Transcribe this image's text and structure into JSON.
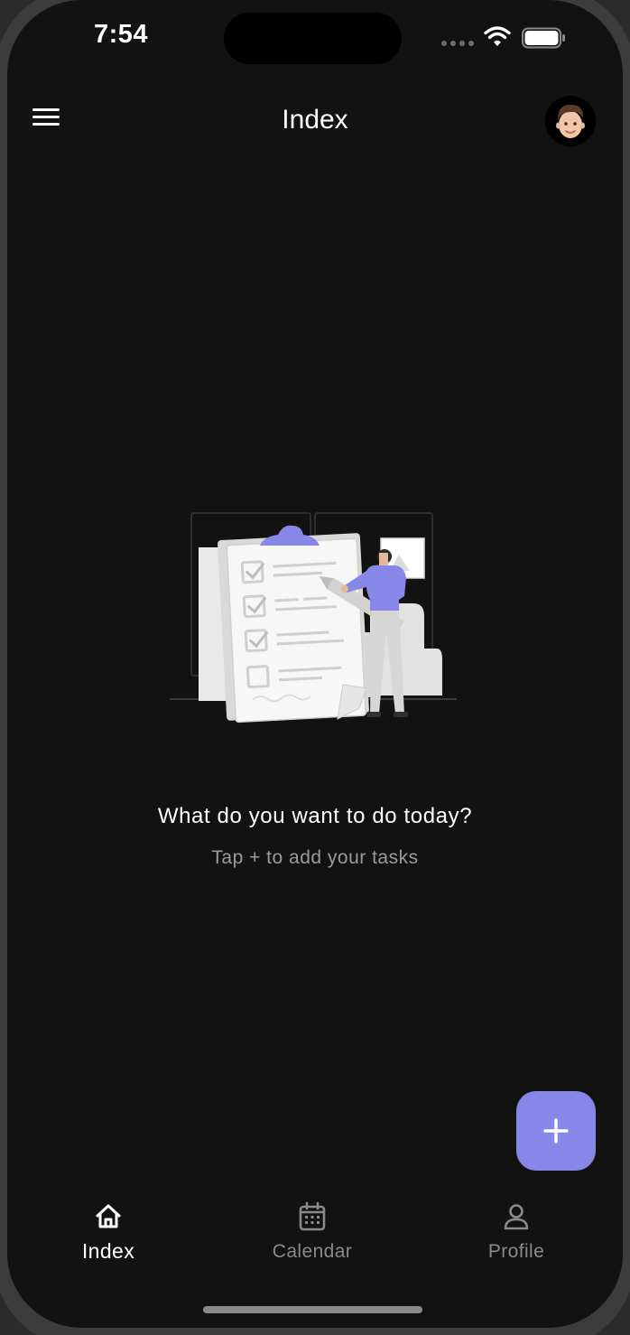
{
  "status_bar": {
    "time": "7:54",
    "icons": [
      "signal-dots-icon",
      "wifi-icon",
      "battery-icon"
    ]
  },
  "app_bar": {
    "title": "Index",
    "menu_icon": "hamburger-menu-icon",
    "avatar": "memoji-avatar"
  },
  "empty_state": {
    "illustration": "checklist-clipboard-illustration",
    "heading": "What do you want to do today?",
    "subtext": "Tap + to add your tasks"
  },
  "fab": {
    "icon": "plus-icon",
    "color": "#8687E7"
  },
  "bottom_nav": {
    "items": [
      {
        "label": "Index",
        "icon": "home-icon",
        "active": true
      },
      {
        "label": "Calendar",
        "icon": "calendar-icon",
        "active": false
      },
      {
        "label": "Profile",
        "icon": "user-icon",
        "active": false
      }
    ]
  },
  "colors": {
    "background": "#121212",
    "accent": "#8687E7",
    "text_primary": "#FFFFFF",
    "text_secondary": "#9B9B9B"
  }
}
